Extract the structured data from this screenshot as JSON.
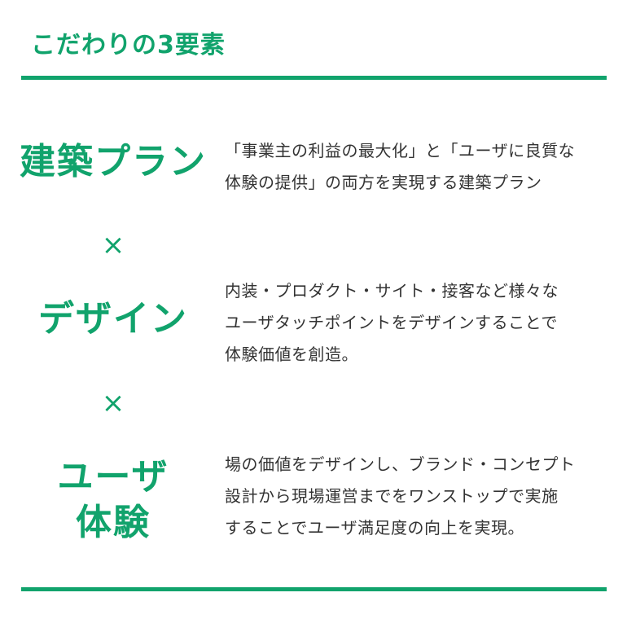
{
  "section": {
    "title": "こだわりの3要素"
  },
  "items": [
    {
      "heading": "建築プラン",
      "desc_lines": [
        "「事業主の利益の最大化」と「ユーザに良質な",
        "体験の提供」の両方を実現する建築プラン"
      ]
    },
    {
      "heading": "デザイン",
      "desc_lines": [
        "内装・プロダクト・サイト・接客など様々な",
        "ユーザタッチポイントをデザインすることで",
        "体験価値を創造。"
      ]
    },
    {
      "heading_lines": [
        "ユーザ",
        "体験"
      ],
      "desc_lines": [
        "場の価値をデザインし、ブランド・コンセプト",
        "設計から現場運営までをワンストップで実施",
        "することでユーザ満足度の向上を実現。"
      ]
    }
  ],
  "separator": "×",
  "colors": {
    "accent": "#11a36c",
    "text": "#333333"
  }
}
